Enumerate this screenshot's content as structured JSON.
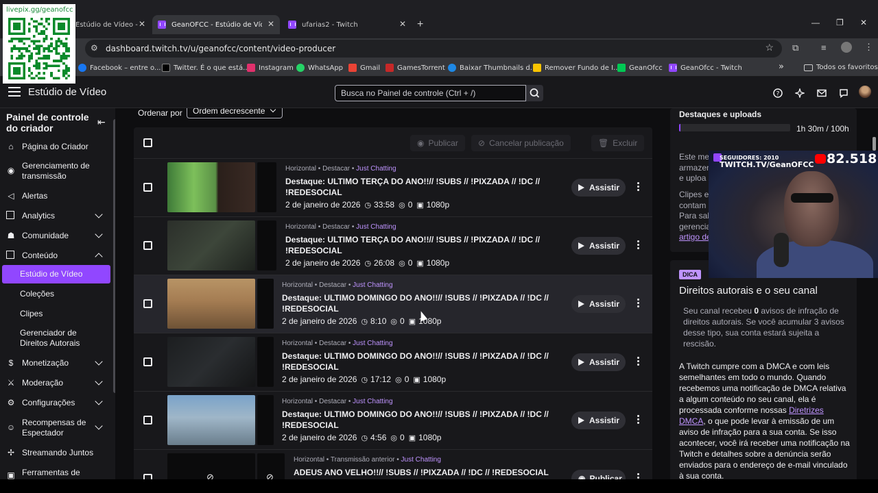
{
  "browser": {
    "tabs": [
      {
        "label": "Estúdio de Vídeo -",
        "close": "✕"
      },
      {
        "label": "GeanOFCC - Estúdio de Vídeo",
        "close": "✕"
      },
      {
        "label": "ufarias2 - Twitch",
        "close": "✕"
      }
    ],
    "new_tab": "+",
    "url": "dashboard.twitch.tv/u/geanofcc/content/video-producer",
    "bookmarks": [
      {
        "label": "Facebook – entre o...",
        "color": "#1877f2"
      },
      {
        "label": "Twitter. É o que está...",
        "color": "#000000"
      },
      {
        "label": "Instagram",
        "color": "#e1306c"
      },
      {
        "label": "WhatsApp",
        "color": "#25d366"
      },
      {
        "label": "Gmail",
        "color": "#ea4335"
      },
      {
        "label": "GamesTorrent",
        "color": "#c62828"
      },
      {
        "label": "Baixar Thumbnails d...",
        "color": "#1e88e5"
      },
      {
        "label": "Remover Fundo de I...",
        "color": "#f9c400"
      },
      {
        "label": "GeanOfcc",
        "color": "#00c853"
      },
      {
        "label": "GeanOfcc - Twitch",
        "color": "#9146ff"
      }
    ],
    "more": "»",
    "all_favorites": "Todos os favoritos"
  },
  "topnav": {
    "title": "Estúdio de Vídeo",
    "search_placeholder": "Busca no Painel de controle (Ctrl + /)"
  },
  "sidebar": {
    "title": "Painel de controle do criador",
    "items": [
      {
        "label": "Página do Criador",
        "icon": "home-icon"
      },
      {
        "label": "Gerenciamento de transmissão",
        "icon": "broadcast-icon"
      },
      {
        "label": "Alertas",
        "icon": "megaphone-icon"
      },
      {
        "label": "Analytics",
        "icon": "analytics-icon"
      },
      {
        "label": "Comunidade",
        "icon": "community-icon"
      },
      {
        "label": "Conteúdo",
        "icon": "content-icon"
      },
      {
        "label": "Monetização",
        "icon": "money-icon"
      },
      {
        "label": "Moderação",
        "icon": "sword-icon"
      },
      {
        "label": "Configurações",
        "icon": "gear-icon"
      },
      {
        "label": "Recompensas de Espectador",
        "icon": "reward-icon"
      },
      {
        "label": "Streamando Juntos",
        "icon": "together-icon"
      },
      {
        "label": "Ferramentas de",
        "icon": "tools-icon"
      }
    ],
    "sub_items": [
      {
        "label": "Estúdio de Vídeo"
      },
      {
        "label": "Coleções"
      },
      {
        "label": "Clipes"
      },
      {
        "label": "Gerenciador de Direitos Autorais"
      }
    ]
  },
  "main": {
    "sort_label": "Ordenar por",
    "sort_value": "Ordem decrescente",
    "bulk": {
      "publish": "Publicar",
      "unpublish": "Cancelar publicação",
      "delete": "Excluir"
    },
    "videos": [
      {
        "type": "Horizontal",
        "kind": "Destacar",
        "category": "Just Chatting",
        "title": "Destaque: ULTIMO TERÇA DO ANO!!// !SUBS // !PIXZADA // !DC // !REDESOCIAL",
        "date": "2 de janeiro de 2026",
        "duration": "33:58",
        "views": "0",
        "quality": "1080p",
        "action": "Assistir"
      },
      {
        "type": "Horizontal",
        "kind": "Destacar",
        "category": "Just Chatting",
        "title": "Destaque: ULTIMO TERÇA DO ANO!!// !SUBS // !PIXZADA // !DC // !REDESOCIAL",
        "date": "2 de janeiro de 2026",
        "duration": "26:08",
        "views": "0",
        "quality": "1080p",
        "action": "Assistir"
      },
      {
        "type": "Horizontal",
        "kind": "Destacar",
        "category": "Just Chatting",
        "title": "Destaque: ULTIMO DOMINGO DO ANO!!// !SUBS // !PIXZADA // !DC // !REDESOCIAL",
        "date": "2 de janeiro de 2026",
        "duration": "8:10",
        "views": "0",
        "quality": "1080p",
        "action": "Assistir"
      },
      {
        "type": "Horizontal",
        "kind": "Destacar",
        "category": "Just Chatting",
        "title": "Destaque: ULTIMO DOMINGO DO ANO!!// !SUBS // !PIXZADA // !DC // !REDESOCIAL",
        "date": "2 de janeiro de 2026",
        "duration": "17:12",
        "views": "0",
        "quality": "1080p",
        "action": "Assistir"
      },
      {
        "type": "Horizontal",
        "kind": "Destacar",
        "category": "Just Chatting",
        "title": "Destaque: ULTIMO DOMINGO DO ANO!!// !SUBS // !PIXZADA // !DC // !REDESOCIAL",
        "date": "2 de janeiro de 2026",
        "duration": "4:56",
        "views": "0",
        "quality": "1080p",
        "action": "Assistir"
      },
      {
        "type": "Horizontal",
        "kind": "Transmissão anterior",
        "category": "Just Chatting",
        "title": "ADEUS ANO VELHO!!// !SUBS // !PIXZADA // !DC // !REDESOCIAL",
        "date": "",
        "duration": "",
        "views": "",
        "quality": "",
        "action": "Publicar"
      }
    ]
  },
  "right": {
    "highlights_title": "Destaques e uploads",
    "progress_fraction": 0.015,
    "progress_text": "1h 30m / 100h",
    "para1": [
      "Este me",
      "armazen",
      "e uploa"
    ],
    "para2": [
      "Clipes e",
      "contam",
      "Para sab",
      "gerencia"
    ],
    "para2_link": "artigo de",
    "tip_badge": "DICA",
    "copyright_title": "Direitos autorais e o seu canal",
    "copyright_p1_a": "Seu canal recebeu ",
    "copyright_p1_b": "0",
    "copyright_p1_c": " avisos de infração de direitos autorais. Se você acumular 3 avisos desse tipo, sua conta estará sujeita a rescisão.",
    "copyright_p2_a": "A Twitch cumpre com a DMCA e com leis semelhantes em todo o mundo. Quando recebemos uma notificação de DMCA relativa a algum conteúdo no seu canal, ela é processada conforme nossas ",
    "copyright_p2_link": "Diretrizes DMCA",
    "copyright_p2_b": ", o que pode levar à emissão de um aviso de infração para a sua conta. Se isso acontecer, você irá receber uma notificação na Twitch e detalhes sobre a denúncia serão enviados para o endereço de e-mail vinculado à sua conta."
  },
  "overlay": {
    "qr_label": "livepix.gg/geanofcc",
    "followers": "SEGUIDORES: 2010",
    "channel": "TWITCH.TV/GeanOFCC",
    "count": "82.518"
  },
  "colors": {
    "accent": "#9147ff",
    "link": "#bf94ff",
    "bg": "#0e0e10",
    "panel": "#18181b"
  }
}
